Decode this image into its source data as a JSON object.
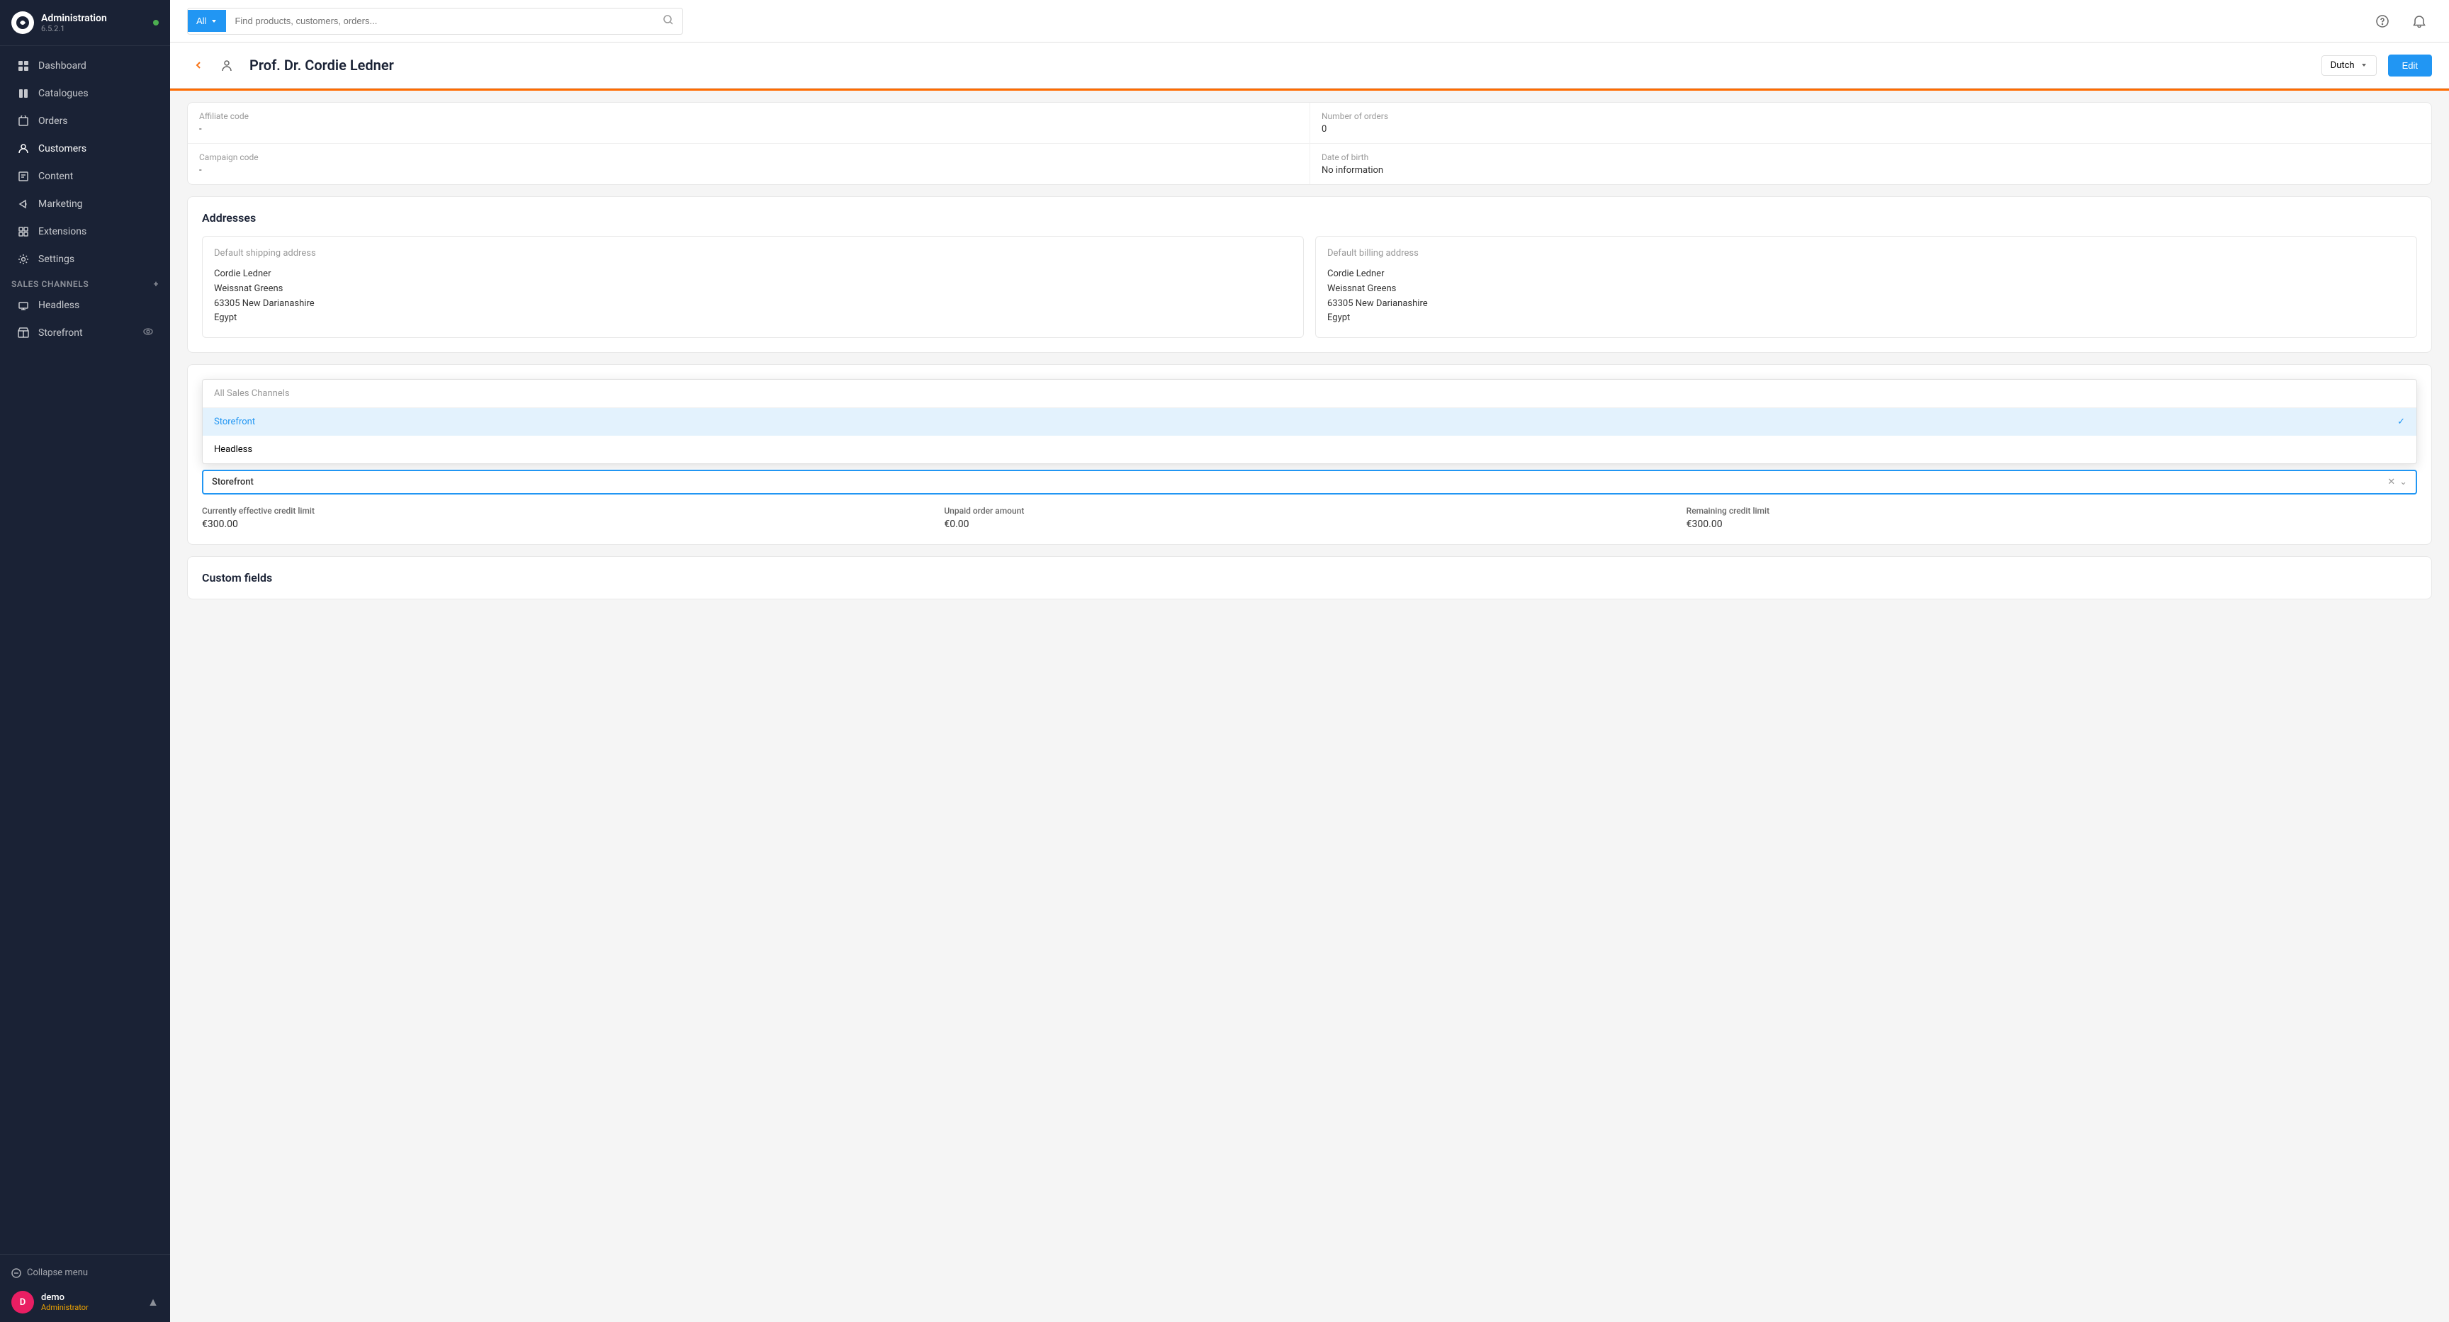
{
  "app": {
    "name": "Administration",
    "version": "6.5.2.1",
    "status": "online"
  },
  "sidebar": {
    "nav_items": [
      {
        "id": "dashboard",
        "label": "Dashboard",
        "icon": "grid"
      },
      {
        "id": "catalogues",
        "label": "Catalogues",
        "icon": "book"
      },
      {
        "id": "orders",
        "label": "Orders",
        "icon": "shopping-bag"
      },
      {
        "id": "customers",
        "label": "Customers",
        "icon": "users",
        "active": true
      },
      {
        "id": "content",
        "label": "Content",
        "icon": "file-text"
      },
      {
        "id": "marketing",
        "label": "Marketing",
        "icon": "megaphone"
      },
      {
        "id": "extensions",
        "label": "Extensions",
        "icon": "puzzle"
      },
      {
        "id": "settings",
        "label": "Settings",
        "icon": "gear"
      }
    ],
    "sales_channels_label": "Sales Channels",
    "channels": [
      {
        "id": "headless",
        "label": "Headless",
        "icon": "server"
      },
      {
        "id": "storefront",
        "label": "Storefront",
        "icon": "monitor"
      }
    ],
    "collapse_label": "Collapse menu",
    "user": {
      "name": "demo",
      "role": "Administrator",
      "avatar_letter": "D"
    }
  },
  "topbar": {
    "search_filter": "All",
    "search_placeholder": "Find products, customers, orders..."
  },
  "page": {
    "title": "Prof. Dr. Cordie Ledner",
    "language": "Dutch",
    "edit_label": "Edit",
    "back_label": "Back"
  },
  "customer_info": {
    "affiliate_code_label": "Affiliate code",
    "affiliate_code_value": "-",
    "number_of_orders_label": "Number of orders",
    "number_of_orders_value": "0",
    "campaign_code_label": "Campaign code",
    "campaign_code_value": "-",
    "date_of_birth_label": "Date of birth",
    "date_of_birth_value": "No information"
  },
  "addresses": {
    "section_title": "Addresses",
    "shipping": {
      "title": "Default shipping address",
      "name": "Cordie Ledner",
      "street": "Weissnat Greens",
      "city_zip": "63305 New Darianashire",
      "country": "Egypt"
    },
    "billing": {
      "title": "Default billing address",
      "name": "Cordie Ledner",
      "street": "Weissnat Greens",
      "city_zip": "63305 New Darianashire",
      "country": "Egypt"
    }
  },
  "sales_channel_selector": {
    "all_label": "All Sales Channels",
    "options": [
      {
        "id": "storefront",
        "label": "Storefront",
        "selected": true
      },
      {
        "id": "headless",
        "label": "Headless",
        "selected": false
      }
    ],
    "current_value": "Storefront"
  },
  "credit": {
    "effective_limit_label": "Currently effective credit limit",
    "effective_limit_value": "€300.00",
    "unpaid_amount_label": "Unpaid order amount",
    "unpaid_amount_value": "€0.00",
    "remaining_limit_label": "Remaining credit limit",
    "remaining_limit_value": "€300.00"
  },
  "custom_fields": {
    "section_title": "Custom fields"
  }
}
